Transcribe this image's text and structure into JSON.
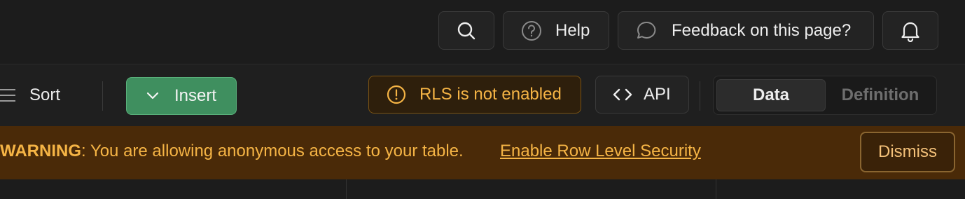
{
  "header": {
    "search_icon": "search-icon",
    "help_label": "Help",
    "feedback_label": "Feedback on this page?",
    "notifications_icon": "bell-icon"
  },
  "toolbar": {
    "sort_label": "Sort",
    "insert_label": "Insert",
    "rls_label": "RLS is not enabled",
    "api_label": "API",
    "view_tabs": [
      {
        "label": "Data",
        "active": true
      },
      {
        "label": "Definition",
        "active": false
      }
    ]
  },
  "warning": {
    "prefix": "WARNING",
    "message": ": You are allowing anonymous access to your table.",
    "link_label": "Enable Row Level Security",
    "dismiss_label": "Dismiss"
  },
  "colors": {
    "background": "#1c1c1c",
    "insert_green": "#3f8f5f",
    "warning_bg": "#4a2a08",
    "warning_text": "#f5b445"
  }
}
